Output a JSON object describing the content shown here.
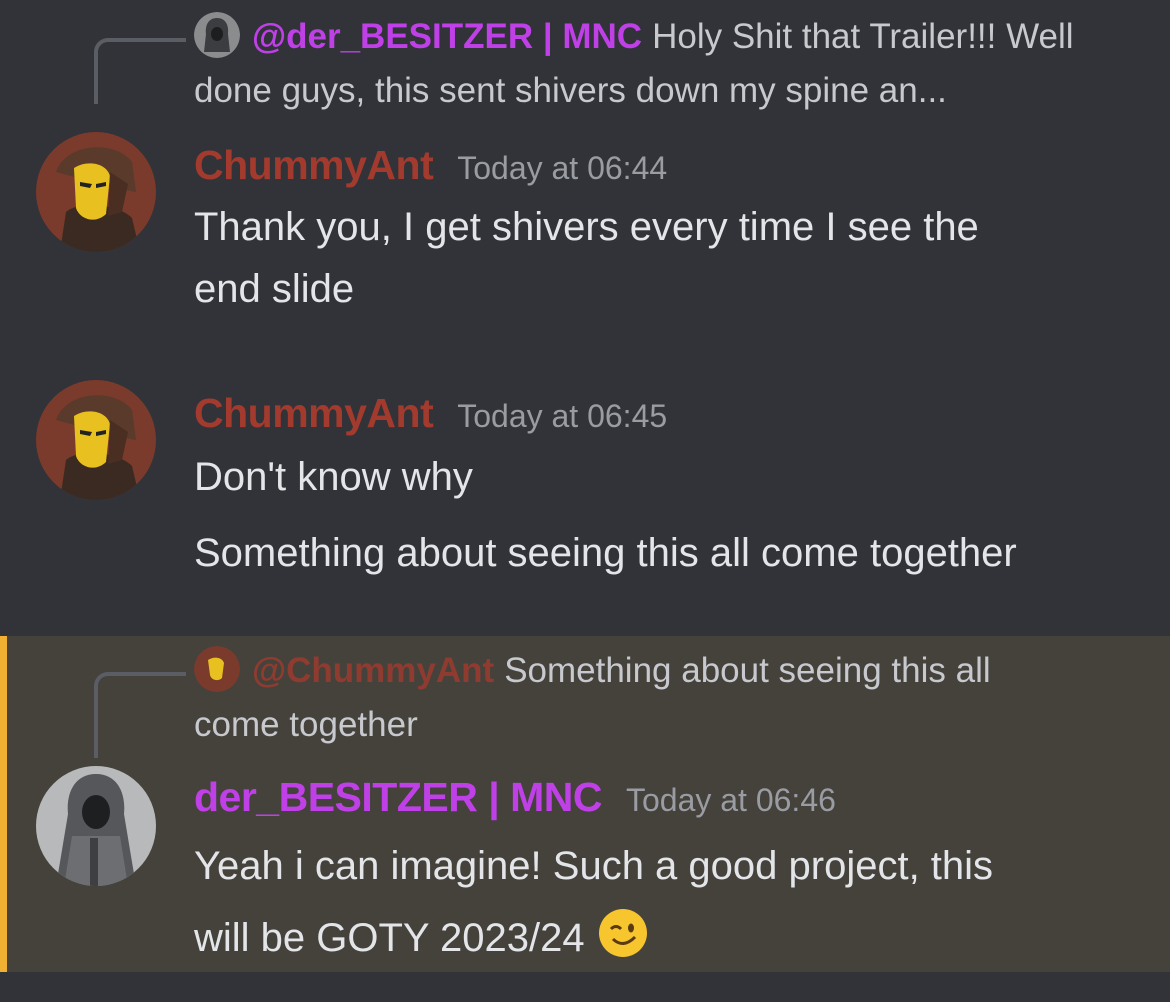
{
  "colors": {
    "background": "#313338",
    "highlight_bg": "#45423c",
    "highlight_bar": "#f0b132",
    "chummy_name": "#a23a2e",
    "besitzer_name": "#c040e8"
  },
  "messages": [
    {
      "reply": {
        "avatar_icon": "hooded-figure-avatar-icon",
        "mention": "@der_BESITZER | MNC",
        "quote": "Holy Shit that Trailer!!! Well done guys, this sent shivers down my spine an..."
      },
      "author": "ChummyAnt",
      "avatar_icon": "masked-figure-avatar-icon",
      "timestamp": "Today at 06:44",
      "lines": [
        "Thank you, I get shivers every time I see the",
        "end slide"
      ]
    },
    {
      "author": "ChummyAnt",
      "avatar_icon": "masked-figure-avatar-icon",
      "timestamp": "Today at 06:45",
      "lines": [
        "Don't know why",
        "Something about seeing this all come together"
      ]
    },
    {
      "highlighted": true,
      "reply": {
        "avatar_icon": "masked-figure-avatar-icon",
        "mention": "@ChummyAnt",
        "quote_line1": "Something about seeing this all",
        "quote_line2": "come together"
      },
      "author": "der_BESITZER | MNC",
      "avatar_icon": "hooded-figure-avatar-icon",
      "timestamp": "Today at 06:46",
      "lines": [
        "Yeah i can imagine! Such a good project, this",
        "will be GOTY 2023/24"
      ],
      "emoji": "winking-face-emoji"
    }
  ]
}
